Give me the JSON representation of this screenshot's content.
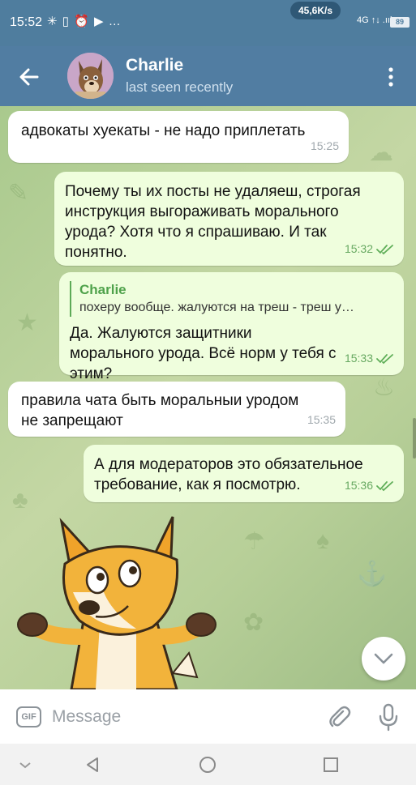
{
  "status_bar": {
    "time": "15:52",
    "left_icons": "✳ ▯ ⏰ ▶ …",
    "network_speed": "45,6K/s",
    "signal": "4G ↑↓ .ııl",
    "battery": "89"
  },
  "header": {
    "name": "Charlie",
    "status": "last seen recently"
  },
  "messages": [
    {
      "side": "in",
      "text": "адвокаты хуекаты - не надо приплетать",
      "time": "15:25"
    },
    {
      "side": "out",
      "text": "Почему ты их посты не удаляеш, строгая инструкция выгораживать морального урода? Хотя что я спрашиваю. И так понятно.",
      "time": "15:32"
    },
    {
      "side": "out",
      "reply": {
        "name": "Charlie",
        "text": "похеру вообще. жалуются на треш - треш у…"
      },
      "text": "Да. Жалуются защитники морального урода. Всё норм у тебя с этим?",
      "time": "15:33"
    },
    {
      "side": "in",
      "text": "правила чата быть моральныи уродом не запрещают",
      "time": "15:35"
    },
    {
      "side": "out",
      "text": "А для модераторов это обязательное требование, как я посмотрю.",
      "time": "15:36"
    }
  ],
  "input": {
    "gif_label": "GIF",
    "placeholder": "Message"
  },
  "colors": {
    "header": "#517da2",
    "incoming_bubble": "#ffffff",
    "outgoing_bubble": "#effedd",
    "accent_green": "#4fa24b"
  }
}
